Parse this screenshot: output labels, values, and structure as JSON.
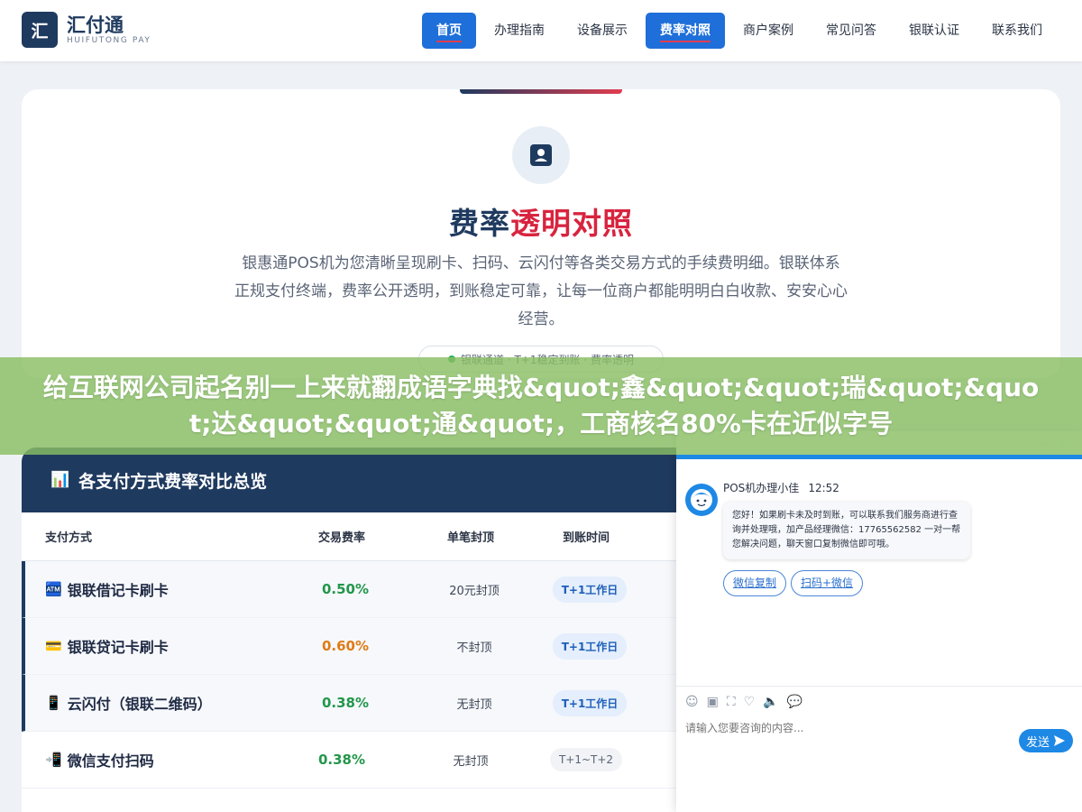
{
  "brand": {
    "logo_char": "汇",
    "name_cn": "汇付通",
    "name_en": "HUIFUTONG PAY"
  },
  "nav": {
    "items": [
      "首页",
      "办理指南",
      "设备展示",
      "费率对照",
      "商户案例",
      "常见问答",
      "银联认证",
      "联系我们"
    ],
    "active": [
      "首页",
      "费率对照"
    ]
  },
  "hero": {
    "icon": "id-card-icon",
    "title_main": "费率",
    "title_accent": "透明对照",
    "description": "银惠通POS机为您清晰呈现刷卡、扫码、云闪付等各类交易方式的手续费明细。银联体系正规支付终端，费率公开透明，到账稳定可靠，让每一位商户都能明明白白收款、安安心心经营。",
    "pill": "银联通道 · T+1稳定到账 · 费率透明"
  },
  "banner": {
    "text": "给互联网公司起名别一上来就翻成语字典找&quot;鑫&quot;&quot;瑞&quot;&quot;达&quot;&quot;通&quot;，工商核名80%卡在近似字号"
  },
  "table": {
    "title": "各支付方式费率对比总览",
    "title_icon": "bar-chart-icon",
    "headers": [
      "支付方式",
      "交易费率",
      "单笔封顶",
      "到账时间"
    ],
    "rows": [
      {
        "emoji": "🏧",
        "method": "银联借记卡刷卡",
        "rate": "0.50%",
        "rate_color": "#23964b",
        "cap": "20元封顶",
        "arrival": "T+1工作日",
        "arrival_style": "blue"
      },
      {
        "emoji": "💳",
        "method": "银联贷记卡刷卡",
        "rate": "0.60%",
        "rate_color": "#e07b16",
        "cap": "不封顶",
        "arrival": "T+1工作日",
        "arrival_style": "blue"
      },
      {
        "emoji": "📱",
        "method": "云闪付（银联二维码）",
        "rate": "0.38%",
        "rate_color": "#23964b",
        "cap": "无封顶",
        "arrival": "T+1工作日",
        "arrival_style": "blue"
      },
      {
        "emoji": "📲",
        "method": "微信支付扫码",
        "rate": "0.38%",
        "rate_color": "#23964b",
        "cap": "无封顶",
        "arrival": "T+1~T+2",
        "arrival_style": "grey"
      }
    ]
  },
  "chat": {
    "window_buttons": [
      "minimize-icon",
      "maximize-icon"
    ],
    "agent_name": "POS机办理小佳",
    "time": "12:52",
    "message": "您好！如果刷卡未及时到账，可以联系我们服务商进行查询并处理哦，加产品经理微信：17765562582 一对一帮您解决问题，聊天窗口复制微信即可哦。",
    "quick_replies": [
      "微信复制",
      "扫码+微信"
    ],
    "tools": [
      "emoji-icon",
      "image-icon",
      "screenshot-icon",
      "rating-icon",
      "voice-icon",
      "chat-bubbles-icon"
    ],
    "input_placeholder": "请输入您要咨询的内容...",
    "send_label": "发送"
  }
}
